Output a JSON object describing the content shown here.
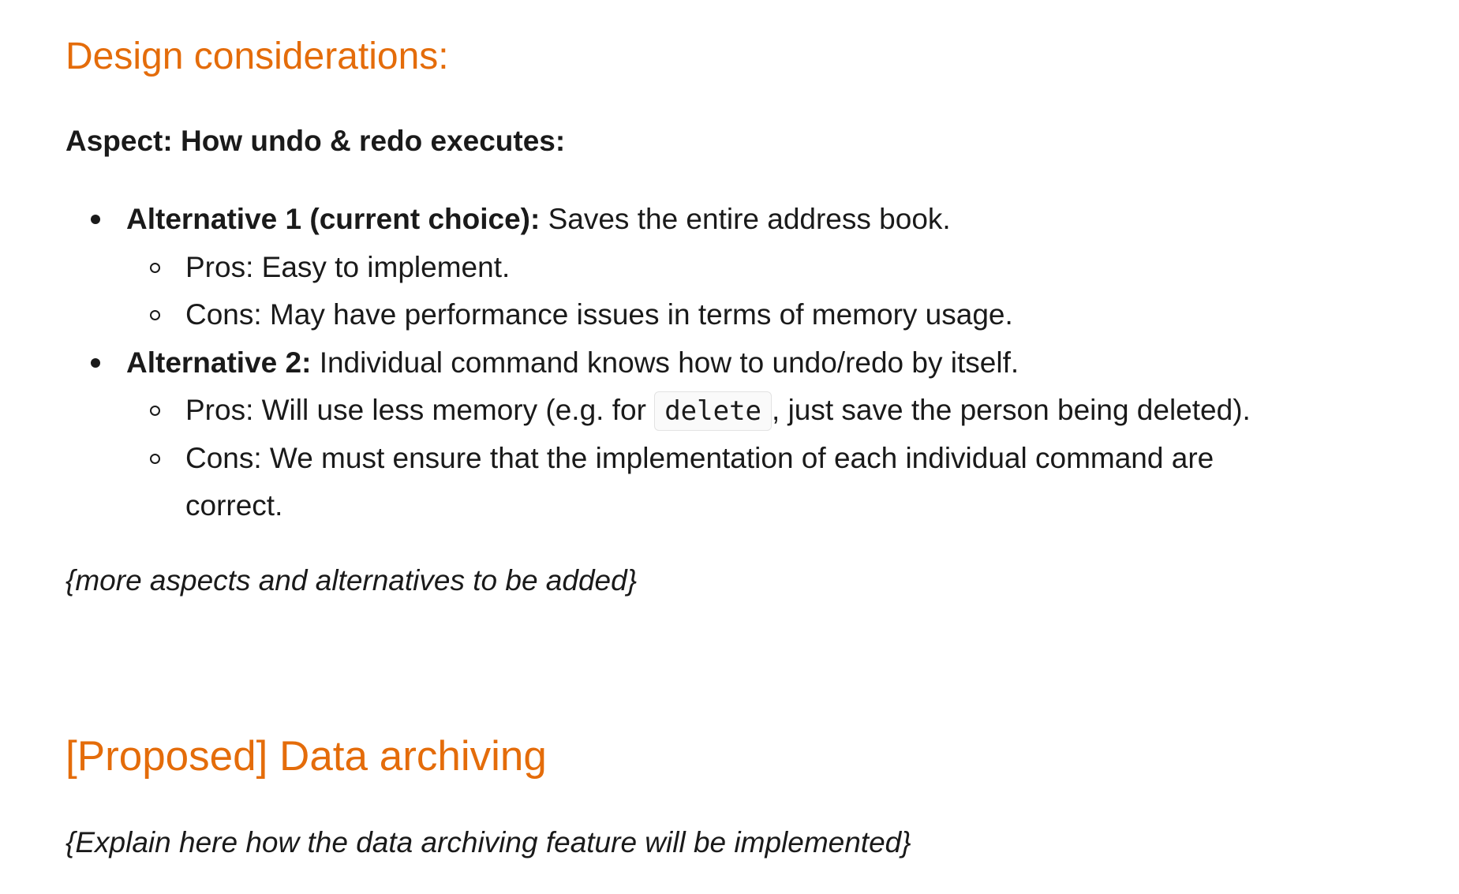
{
  "headings": {
    "design": "Design considerations:",
    "archiving": "[Proposed] Data archiving"
  },
  "aspect": "Aspect: How undo & redo executes:",
  "alternatives": [
    {
      "label": "Alternative 1 (current choice):",
      "text": " Saves the entire address book.",
      "pros": "Pros: Easy to implement.",
      "cons": "Cons: May have performance issues in terms of memory usage."
    },
    {
      "label": "Alternative 2:",
      "text": " Individual command knows how to undo/redo by itself.",
      "pros_before": "Pros: Will use less memory (e.g. for ",
      "pros_code": "delete",
      "pros_after": ", just save the person being deleted).",
      "cons_line1": "Cons: We must ensure that the implementation of each individual command are",
      "cons_line2": "correct."
    }
  ],
  "more_note": "{more aspects and alternatives to be added}",
  "archiving_note": "{Explain here how the data archiving feature will be implemented}",
  "colors": {
    "heading": "#e46c0a",
    "text": "#1a1a1a"
  }
}
